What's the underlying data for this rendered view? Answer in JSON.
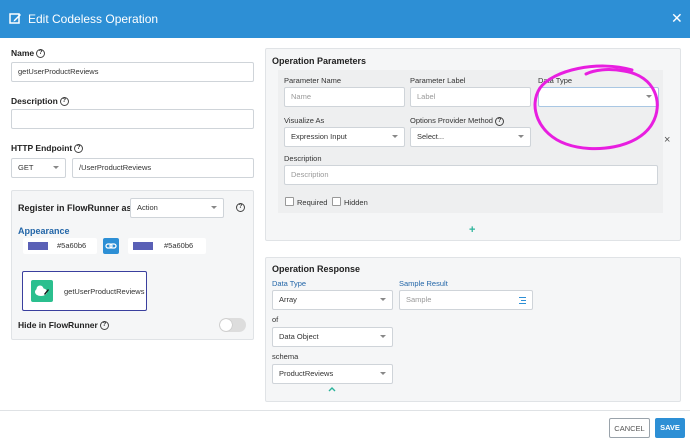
{
  "dialog": {
    "title": "Edit Codeless Operation",
    "close_symbol": "✕"
  },
  "left": {
    "name_label": "Name",
    "name_value": "getUserProductReviews",
    "description_label": "Description",
    "description_value": "",
    "http_label": "HTTP Endpoint",
    "http_method": "GET",
    "http_path": "/UserProductReviews",
    "register_label": "Register in FlowRunner as",
    "register_value": "Action",
    "appearance_label": "Appearance",
    "color1": "#5a60b6",
    "color2": "#5a60b6",
    "card_label": "getUserProductReviews",
    "hide_label": "Hide in FlowRunner",
    "hide_toggle_on": false
  },
  "params": {
    "title": "Operation Parameters",
    "param_name_label": "Parameter Name",
    "param_name_placeholder": "Name",
    "param_label_label": "Parameter Label",
    "param_label_placeholder": "Label",
    "data_type_label": "Data Type",
    "data_type_value": "",
    "visualize_label": "Visualize As",
    "visualize_value": "Expression Input",
    "options_label": "Options Provider Method",
    "options_value": "Select...",
    "description_label": "Description",
    "description_placeholder": "Description",
    "required_label": "Required",
    "hidden_label": "Hidden",
    "remove_symbol": "×",
    "add_symbol": "+"
  },
  "response": {
    "title": "Operation Response",
    "data_type_label": "Data Type",
    "data_type_value": "Array",
    "sample_label": "Sample Result",
    "sample_placeholder": "Sample",
    "of_label": "of",
    "of_value": "Data Object",
    "schema_label": "schema",
    "schema_value": "ProductReviews"
  },
  "footer": {
    "cancel": "CANCEL",
    "save": "SAVE"
  },
  "colors": {
    "header": "#2d8fd5",
    "swatch": "#5a60b6",
    "icon_green": "#2bbf8e",
    "annotation": "#e81ee0",
    "save": "#2d8fd5"
  }
}
